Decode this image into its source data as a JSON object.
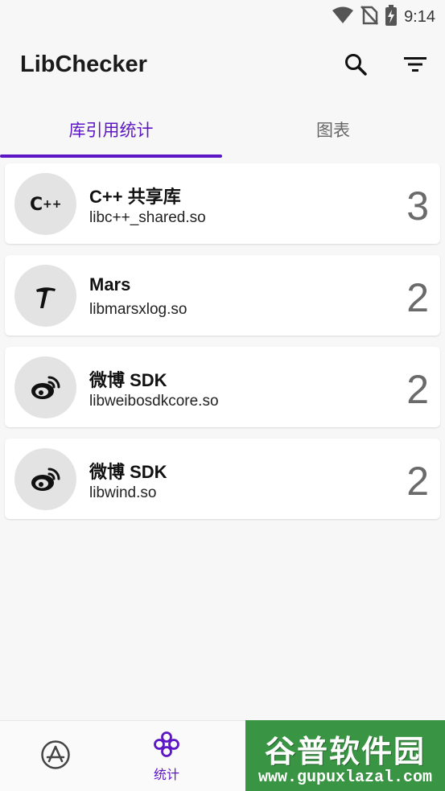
{
  "status_bar": {
    "time": "9:14",
    "icons": [
      "wifi-icon",
      "no-sim-icon",
      "battery-charging-icon"
    ]
  },
  "app_bar": {
    "title": "LibChecker",
    "actions": [
      "search-icon",
      "filter-icon"
    ]
  },
  "tabs": [
    {
      "label": "库引用统计",
      "active": true
    },
    {
      "label": "图表",
      "active": false
    }
  ],
  "libraries": [
    {
      "title": "C++ 共享库",
      "subtitle": "libc++_shared.so",
      "count": "3",
      "icon": "cpp-icon"
    },
    {
      "title": "Mars",
      "subtitle": "libmarsxlog.so",
      "count": "2",
      "icon": "mars-icon"
    },
    {
      "title": "微博 SDK",
      "subtitle": "libweibosdkcore.so",
      "count": "2",
      "icon": "weibo-icon"
    },
    {
      "title": "微博 SDK",
      "subtitle": "libwind.so",
      "count": "2",
      "icon": "weibo-icon"
    }
  ],
  "bottom_nav": {
    "items": [
      {
        "label": "",
        "icon": "app-store-icon",
        "active": false
      },
      {
        "label": "统计",
        "icon": "stats-icon",
        "active": true
      }
    ]
  },
  "watermark": {
    "title": "谷普软件园",
    "url": "www.gupuxlazal.com"
  },
  "colors": {
    "accent": "#5c16c5",
    "background": "#f7f7f7",
    "card": "#ffffff",
    "icon_bg": "#e3e3e3"
  }
}
